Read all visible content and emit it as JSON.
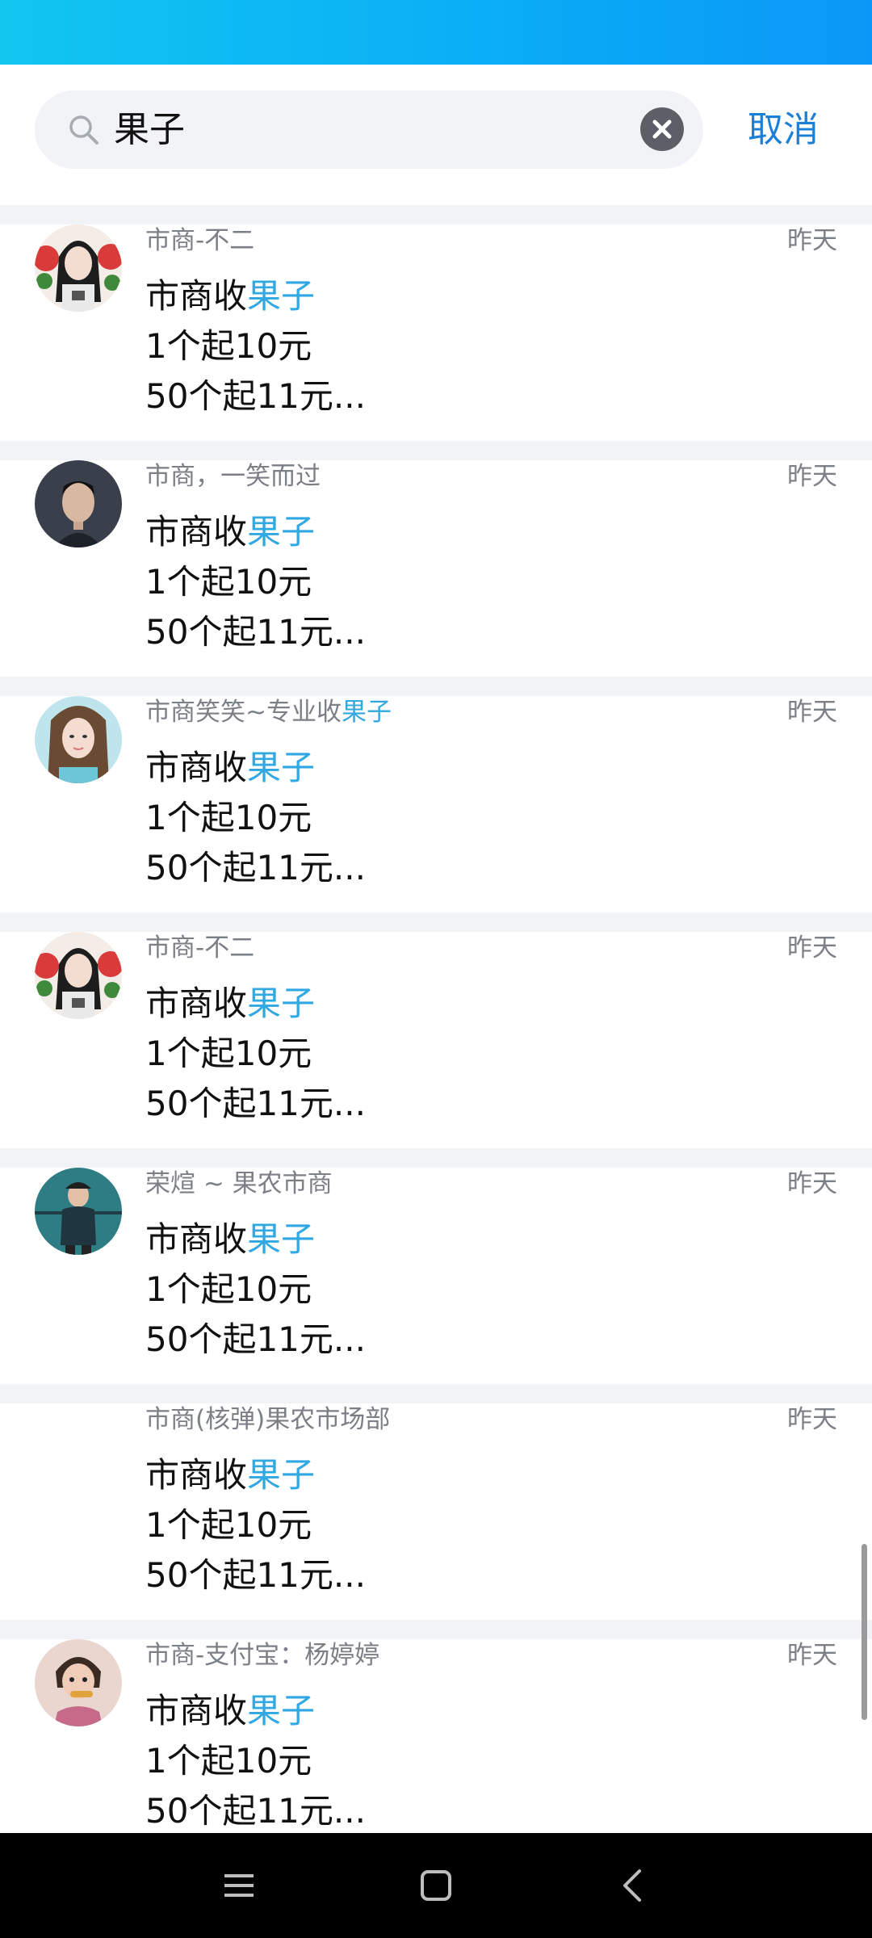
{
  "search": {
    "query": "果子",
    "cancel_label": "取消"
  },
  "results": [
    {
      "name_parts": [
        "市商-不二",
        ""
      ],
      "time": "昨天",
      "msg_prefix": "市商收",
      "msg_highlight": "果子",
      "line2": "1个起10元",
      "line3": "50个起11元...",
      "avatar": "girl-roses-avatar"
    },
    {
      "name_parts": [
        "市商，一笑而过",
        ""
      ],
      "time": "昨天",
      "msg_prefix": "市商收",
      "msg_highlight": "果子",
      "line2": "1个起10元",
      "line3": "50个起11元...",
      "avatar": "man-portrait-avatar"
    },
    {
      "name_parts": [
        "市商笑笑~专业收",
        "果子"
      ],
      "time": "昨天",
      "msg_prefix": "市商收",
      "msg_highlight": "果子",
      "line2": "1个起10元",
      "line3": "50个起11元...",
      "avatar": "woman-portrait-avatar"
    },
    {
      "name_parts": [
        "市商-不二",
        ""
      ],
      "time": "昨天",
      "msg_prefix": "市商收",
      "msg_highlight": "果子",
      "line2": "1个起10元",
      "line3": "50个起11元...",
      "avatar": "girl-roses-avatar"
    },
    {
      "name_parts": [
        "荣煊 ~ 果农市商",
        ""
      ],
      "time": "昨天",
      "msg_prefix": "市商收",
      "msg_highlight": "果子",
      "line2": "1个起10元",
      "line3": "50个起11元...",
      "avatar": "child-teal-avatar"
    },
    {
      "name_parts": [
        "市商(核弹)果农市场部",
        ""
      ],
      "time": "昨天",
      "msg_prefix": "市商收",
      "msg_highlight": "果子",
      "line2": "1个起10元",
      "line3": "50个起11元...",
      "avatar": "none"
    },
    {
      "name_parts": [
        "市商-支付宝：杨婷婷",
        ""
      ],
      "time": "昨天",
      "msg_prefix": "市商收",
      "msg_highlight": "果子",
      "line2": "1个起10元",
      "line3": "50个起11元...",
      "avatar": "child-photo-avatar"
    }
  ],
  "navigation": {
    "icons": [
      "menu-icon",
      "home-square-icon",
      "back-chevron-icon"
    ]
  },
  "colors": {
    "accent": "#1c7fd6",
    "highlight": "#30a9e3",
    "status_bar": "#0aaef6"
  }
}
